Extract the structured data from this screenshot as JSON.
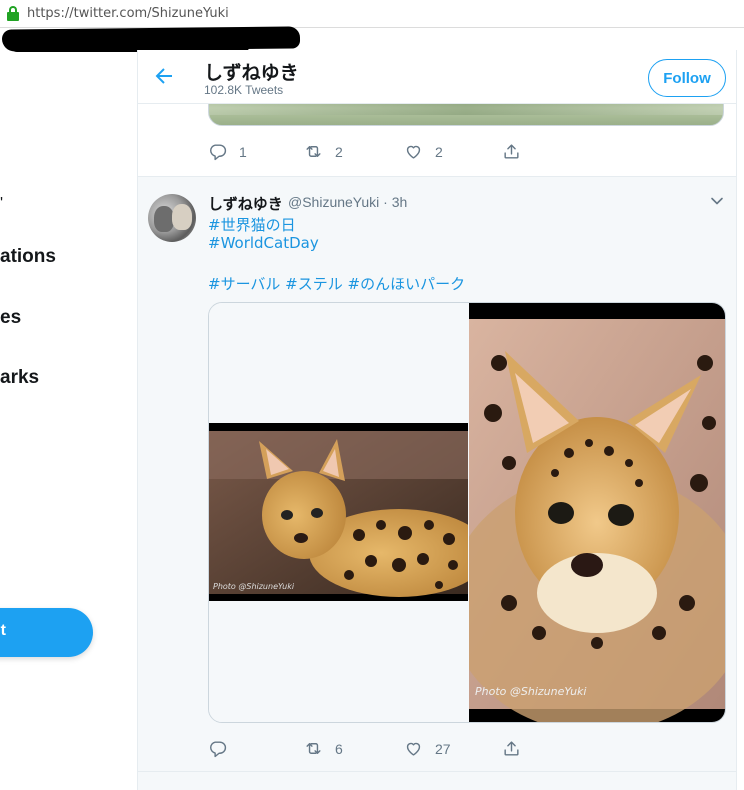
{
  "browser": {
    "url": "https://twitter.com/ShizuneYuki"
  },
  "nav": {
    "items": [
      "ations",
      "es",
      "arks"
    ],
    "tweet_button_label": "t"
  },
  "header": {
    "name": "しずねゆき",
    "tweet_count": "102.8K Tweets",
    "follow_label": "Follow"
  },
  "prev_tweet": {
    "actions": {
      "reply": "1",
      "retweet": "2",
      "like": "2"
    }
  },
  "tweet": {
    "name": "しずねゆき",
    "handle_time": "@ShizuneYuki · 3h",
    "hashtags": [
      "#世界猫の日",
      "#WorldCatDay"
    ],
    "hashtag_line": "#サーバル #ステル #のんほいパーク",
    "media": {
      "left_watermark": "Photo @ShizuneYuki",
      "right_watermark": "Photo @ShizuneYuki"
    },
    "actions": {
      "reply": "",
      "retweet": "6",
      "like": "27"
    }
  },
  "colors": {
    "accent": "#1da1f2",
    "link": "#1b95e0",
    "muted": "#657786",
    "lock": "#21a324"
  }
}
